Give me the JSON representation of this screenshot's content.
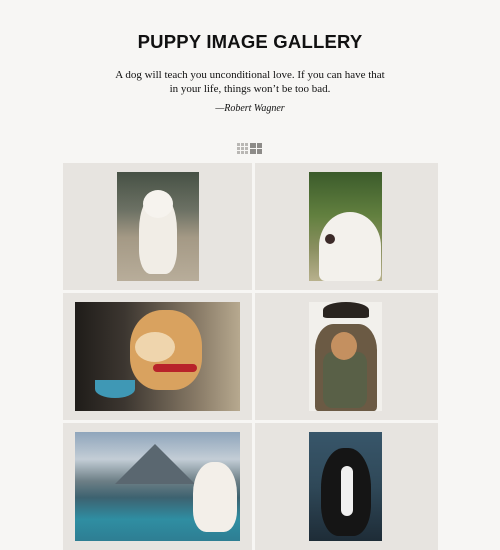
{
  "header": {
    "title": "PUPPY IMAGE GALLERY",
    "quote": "A dog will teach you unconditional love. If you can have that in your life, things won’t be too bad.",
    "author": "—Robert Wagner"
  },
  "view_toggle": {
    "options": [
      "small-grid-icon",
      "large-grid-icon"
    ],
    "selected": "large-grid-icon"
  },
  "gallery": {
    "items": [
      {
        "subject": "white samoyed puppy sitting"
      },
      {
        "subject": "white samoyed yawning"
      },
      {
        "subject": "golden retriever puppy with red collar"
      },
      {
        "subject": "puppy in person's backpack"
      },
      {
        "subject": "samoyed at mountain lake"
      },
      {
        "subject": "black and white border collie"
      }
    ]
  },
  "colors": {
    "page_bg": "#f7f6f4",
    "card_bg": "#e7e4e0",
    "text": "#111111"
  }
}
